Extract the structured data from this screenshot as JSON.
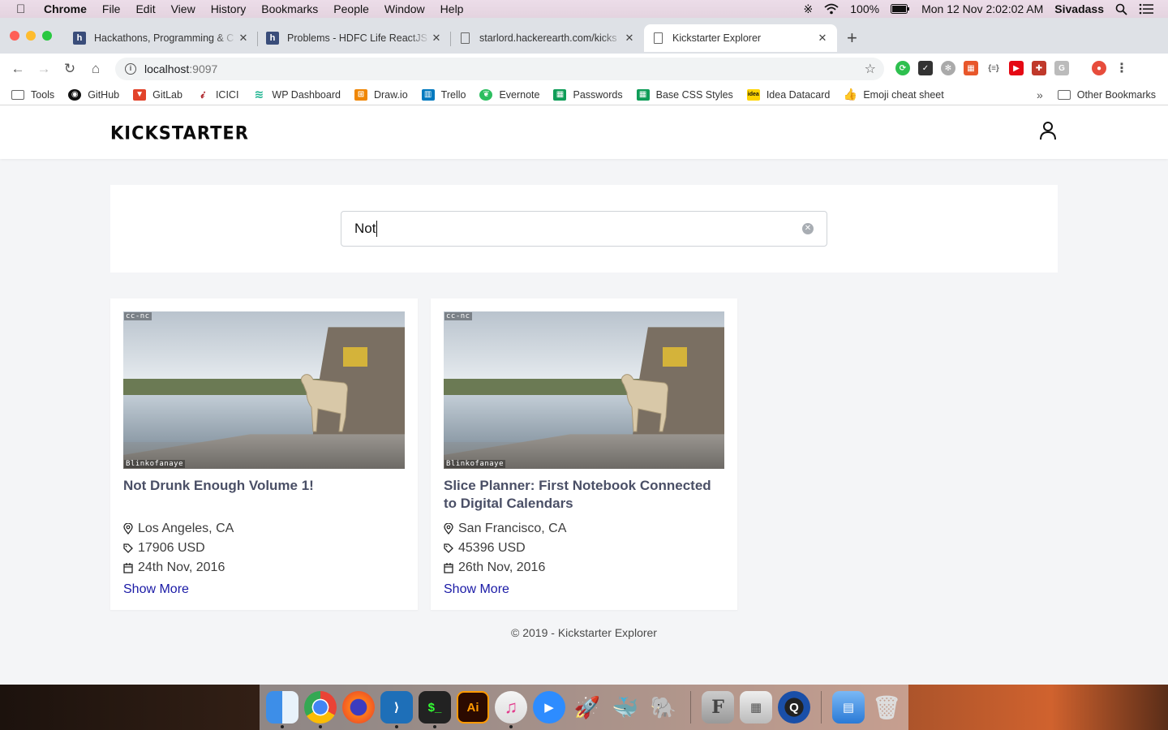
{
  "menubar": {
    "app": "Chrome",
    "items": [
      "File",
      "Edit",
      "View",
      "History",
      "Bookmarks",
      "People",
      "Window",
      "Help"
    ],
    "battery": "100%",
    "datetime": "Mon 12 Nov  2:02:02 AM",
    "user": "Sivadass"
  },
  "tabs": [
    {
      "title": "Hackathons, Programming & C",
      "favicon": "h",
      "color": "#3a4d7a"
    },
    {
      "title": "Problems - HDFC Life ReactJS",
      "favicon": "h",
      "color": "#3a4d7a"
    },
    {
      "title": "starlord.hackerearth.com/kicks",
      "favicon": "doc"
    },
    {
      "title": "Kickstarter Explorer",
      "favicon": "doc"
    }
  ],
  "address": {
    "host": "localhost",
    "port": ":9097"
  },
  "bookmarks": [
    {
      "label": "Tools",
      "icon": "folder-icon",
      "color": "#666666"
    },
    {
      "label": "GitHub",
      "icon": "github-icon",
      "color": "#111111"
    },
    {
      "label": "GitLab",
      "icon": "gitlab-icon",
      "color": "#e2432a"
    },
    {
      "label": "ICICI",
      "icon": "icici-icon",
      "color": "#b02a30"
    },
    {
      "label": "WP Dashboard",
      "icon": "wp-icon",
      "color": "#1bb38f"
    },
    {
      "label": "Draw.io",
      "icon": "drawio-icon",
      "color": "#f08705"
    },
    {
      "label": "Trello",
      "icon": "trello-icon",
      "color": "#0079bf"
    },
    {
      "label": "Evernote",
      "icon": "evernote-icon",
      "color": "#2dbe60"
    },
    {
      "label": "Passwords",
      "icon": "sheets-icon",
      "color": "#0f9d58"
    },
    {
      "label": "Base CSS Styles",
      "icon": "sheets-icon",
      "color": "#0f9d58"
    },
    {
      "label": "Idea Datacard",
      "icon": "idea-icon",
      "color": "#ffd400"
    },
    {
      "label": "Emoji cheat sheet",
      "icon": "thumbs-up-icon",
      "color": "#e8b04a"
    }
  ],
  "other_bookmarks": "Other Bookmarks",
  "site": {
    "logo": "KICKSTARTER",
    "search_value": "Not"
  },
  "cards": [
    {
      "title": "Not Drunk Enough Volume 1!",
      "location": "Los Angeles, CA",
      "amount": "17906 USD",
      "date": "24th Nov, 2016",
      "link": "Show More",
      "wm_top": "cc-nc",
      "wm_bottom": "Blinkofanaye"
    },
    {
      "title": "Slice Planner: First Notebook Connected to Digital Calendars",
      "location": "San Francisco, CA",
      "amount": "45396 USD",
      "date": "26th Nov, 2016",
      "link": "Show More",
      "wm_top": "cc-nc",
      "wm_bottom": "Blinkofanaye"
    }
  ],
  "footer": "© 2019 - Kickstarter Explorer",
  "colors": {
    "accent_link": "#1a1aa6",
    "card_title": "#4a4f66",
    "page_bg": "#f4f5f7"
  }
}
